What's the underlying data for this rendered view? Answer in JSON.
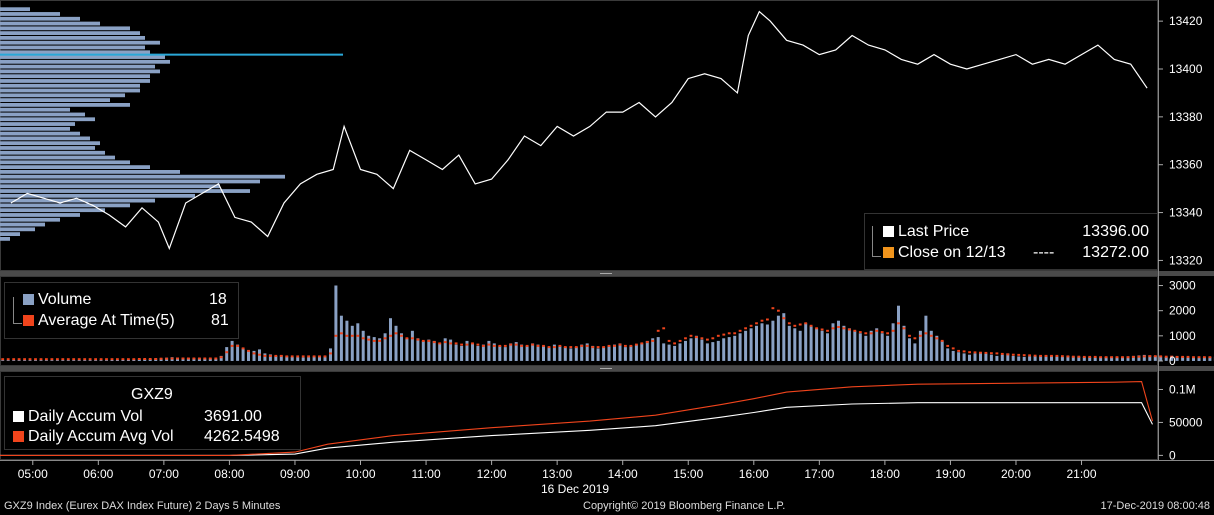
{
  "chart_data": [
    {
      "type": "line",
      "panel": "price",
      "series": [
        {
          "name": "Last Price",
          "color": "#ffffff",
          "x": [
            "04:40",
            "04:55",
            "05:10",
            "05:25",
            "05:40",
            "05:55",
            "06:10",
            "06:25",
            "06:40",
            "06:55",
            "07:05",
            "07:20",
            "07:35",
            "07:50",
            "08:05",
            "08:20",
            "08:35",
            "08:50",
            "09:05",
            "09:20",
            "09:35",
            "09:45",
            "10:00",
            "10:15",
            "10:30",
            "10:45",
            "11:00",
            "11:15",
            "11:30",
            "11:45",
            "12:00",
            "12:15",
            "12:30",
            "12:45",
            "13:00",
            "13:15",
            "13:30",
            "13:45",
            "14:00",
            "14:15",
            "14:30",
            "14:45",
            "15:00",
            "15:15",
            "15:30",
            "15:45",
            "15:55",
            "16:05",
            "16:15",
            "16:30",
            "16:45",
            "17:00",
            "17:15",
            "17:30",
            "17:45",
            "18:00",
            "18:15",
            "18:30",
            "18:45",
            "19:00",
            "19:15",
            "19:30",
            "19:45",
            "20:00",
            "20:15",
            "20:30",
            "20:45",
            "21:00",
            "21:15",
            "21:30",
            "21:45",
            "22:00"
          ],
          "y": [
            13344,
            13348,
            13346,
            13344,
            13346,
            13343,
            13339,
            13334,
            13342,
            13336,
            13325,
            13344,
            13348,
            13352,
            13338,
            13336,
            13330,
            13344,
            13352,
            13356,
            13358,
            13376,
            13358,
            13356,
            13350,
            13366,
            13362,
            13358,
            13364,
            13352,
            13354,
            13362,
            13372,
            13368,
            13376,
            13372,
            13376,
            13382,
            13382,
            13386,
            13380,
            13386,
            13396,
            13398,
            13396,
            13390,
            13414,
            13424,
            13420,
            13412,
            13410,
            13406,
            13408,
            13414,
            13410,
            13408,
            13404,
            13402,
            13406,
            13402,
            13400,
            13402,
            13404,
            13406,
            13402,
            13404,
            13402,
            13406,
            13410,
            13404,
            13402,
            13392
          ]
        },
        {
          "name": "Close on 12/13",
          "color": "#f0941c",
          "constant": 13272.0
        }
      ],
      "xlim": [
        "04:30",
        "22:10"
      ],
      "ylim": [
        13316,
        13428
      ],
      "yticks": [
        13320,
        13340,
        13360,
        13380,
        13400,
        13420
      ],
      "volume_profile": {
        "color": "#8aa1c4",
        "highlight_color": "#2aa8d8",
        "highlight_price": 13406,
        "levels": [
          13329,
          13331,
          13333,
          13335,
          13337,
          13339,
          13341,
          13343,
          13345,
          13347,
          13349,
          13351,
          13353,
          13355,
          13357,
          13359,
          13361,
          13363,
          13365,
          13367,
          13369,
          13371,
          13373,
          13375,
          13377,
          13379,
          13381,
          13383,
          13385,
          13387,
          13389,
          13391,
          13393,
          13395,
          13397,
          13399,
          13401,
          13403,
          13405,
          13407,
          13409,
          13411,
          13413,
          13415,
          13417,
          13419,
          13421,
          13423,
          13425
        ],
        "volumes": [
          10,
          20,
          35,
          45,
          60,
          80,
          105,
          130,
          155,
          195,
          250,
          220,
          260,
          285,
          180,
          150,
          130,
          115,
          105,
          95,
          100,
          90,
          80,
          70,
          75,
          95,
          85,
          70,
          130,
          110,
          125,
          140,
          140,
          150,
          150,
          160,
          155,
          170,
          165,
          150,
          145,
          160,
          145,
          140,
          130,
          100,
          80,
          60,
          30
        ],
        "max_volume": 343
      }
    },
    {
      "type": "bar",
      "panel": "volume",
      "legend": [
        {
          "label": "Volume",
          "value": "18",
          "color": "#8aa1c4"
        },
        {
          "label": "Average At Time(5)",
          "value": "81",
          "color": "#f0441c"
        }
      ],
      "x_start": "04:30",
      "interval_minutes": 5,
      "values": [
        30,
        30,
        30,
        30,
        30,
        30,
        30,
        30,
        30,
        30,
        30,
        30,
        30,
        30,
        30,
        30,
        30,
        30,
        30,
        30,
        40,
        40,
        50,
        50,
        60,
        70,
        80,
        80,
        100,
        110,
        130,
        150,
        140,
        130,
        120,
        110,
        110,
        100,
        100,
        90,
        200,
        550,
        800,
        650,
        500,
        420,
        400,
        460,
        300,
        260,
        200,
        220,
        180,
        160,
        150,
        140,
        150,
        180,
        200,
        190,
        500,
        3000,
        1800,
        1600,
        1400,
        1500,
        1200,
        1000,
        950,
        900,
        1100,
        1700,
        1400,
        1100,
        900,
        1200,
        900,
        800,
        850,
        800,
        700,
        900,
        850,
        650,
        600,
        800,
        700,
        600,
        650,
        800,
        700,
        600,
        550,
        700,
        750,
        650,
        600,
        700,
        650,
        600,
        550,
        650,
        600,
        550,
        500,
        550,
        650,
        700,
        600,
        500,
        550,
        600,
        650,
        700,
        550,
        600,
        650,
        700,
        800,
        900,
        950,
        700,
        650,
        600,
        700,
        800,
        900,
        1000,
        850,
        700,
        750,
        800,
        900,
        950,
        1000,
        1100,
        1200,
        1300,
        1400,
        1500,
        1450,
        1600,
        1800,
        1900,
        1400,
        1300,
        1200,
        1500,
        1400,
        1300,
        1200,
        1100,
        1500,
        1600,
        1400,
        1300,
        1200,
        1100,
        1000,
        1200,
        1300,
        1100,
        1000,
        1500,
        2200,
        1400,
        900,
        700,
        1200,
        1800,
        1200,
        1000,
        800,
        500,
        400,
        350,
        300,
        250,
        300,
        350,
        300,
        250,
        200,
        250,
        300,
        200,
        180,
        160,
        180,
        200,
        200,
        220,
        200,
        180,
        160,
        200,
        180,
        170,
        160,
        150,
        140,
        150,
        160,
        170,
        160,
        150,
        180,
        200,
        220,
        240,
        220,
        200,
        180,
        160,
        200,
        180,
        160,
        150,
        140,
        130,
        150,
        160,
        170,
        180,
        200,
        220,
        240,
        260,
        280,
        300,
        320,
        280,
        260,
        240,
        220,
        200,
        180,
        200,
        220,
        240,
        260,
        280,
        300,
        350,
        400,
        450,
        500,
        350
      ],
      "avg_values": [
        70,
        70,
        70,
        70,
        70,
        70,
        70,
        70,
        70,
        70,
        70,
        70,
        70,
        70,
        70,
        70,
        70,
        70,
        70,
        70,
        70,
        70,
        70,
        70,
        70,
        80,
        80,
        80,
        80,
        90,
        90,
        100,
        100,
        100,
        100,
        100,
        100,
        100,
        100,
        100,
        150,
        350,
        600,
        600,
        500,
        400,
        300,
        250,
        200,
        200,
        200,
        200,
        180,
        180,
        180,
        180,
        180,
        180,
        180,
        180,
        300,
        1000,
        1100,
        1000,
        1000,
        1000,
        900,
        850,
        800,
        800,
        900,
        1000,
        1100,
        1000,
        900,
        900,
        850,
        800,
        800,
        750,
        700,
        750,
        700,
        700,
        650,
        650,
        700,
        650,
        600,
        650,
        600,
        600,
        600,
        650,
        650,
        600,
        600,
        650,
        600,
        600,
        550,
        550,
        600,
        550,
        550,
        550,
        600,
        600,
        550,
        550,
        550,
        600,
        600,
        650,
        600,
        600,
        650,
        700,
        750,
        800,
        1200,
        1300,
        800,
        700,
        800,
        900,
        1000,
        950,
        900,
        850,
        900,
        1000,
        1050,
        1100,
        1100,
        1200,
        1300,
        1400,
        1500,
        1600,
        1650,
        2100,
        2000,
        1700,
        1500,
        1400,
        1450,
        1500,
        1400,
        1300,
        1250,
        1200,
        1300,
        1350,
        1300,
        1250,
        1200,
        1150,
        1100,
        1100,
        1200,
        1150,
        1100,
        1200,
        1500,
        1300,
        1000,
        900,
        1000,
        1100,
        1000,
        900,
        800,
        600,
        500,
        400,
        380,
        350,
        340,
        330,
        320,
        310,
        300,
        280,
        260,
        250,
        240,
        230,
        220,
        210,
        200,
        200,
        200,
        200,
        190,
        180,
        170,
        170,
        160,
        160,
        160,
        150,
        150,
        150,
        150,
        150,
        150,
        160,
        170,
        180,
        190,
        190,
        180,
        170,
        170,
        160,
        160,
        160,
        150,
        150,
        150,
        150,
        150,
        160,
        160,
        170,
        180,
        190,
        200,
        210,
        220,
        230,
        240,
        250,
        240,
        230,
        220,
        210,
        200,
        200,
        210,
        220,
        230,
        240,
        250,
        270,
        300,
        350,
        400,
        400
      ],
      "ylim": [
        -200,
        3300
      ],
      "yticks": [
        0,
        1000,
        2000,
        3000
      ]
    },
    {
      "type": "line",
      "panel": "accumulated",
      "title": "GXZ9",
      "series": [
        {
          "name": "Daily Accum Vol",
          "value": "3691.00",
          "color": "#ffffff",
          "x": [
            "04:30",
            "08:00",
            "09:00",
            "09:30",
            "10:30",
            "12:00",
            "13:30",
            "14:30",
            "15:30",
            "16:00",
            "16:30",
            "17:30",
            "18:30",
            "21:30",
            "21:55",
            "22:05"
          ],
          "y": [
            0,
            0,
            2000,
            11000,
            20000,
            30000,
            38000,
            45000,
            58000,
            65000,
            73000,
            78000,
            80000,
            80000,
            80000,
            47000
          ]
        },
        {
          "name": "Daily Accum Avg Vol",
          "value": "4262.5498",
          "color": "#f0441c",
          "x": [
            "04:30",
            "08:00",
            "09:00",
            "09:30",
            "10:30",
            "12:00",
            "13:30",
            "14:30",
            "15:30",
            "16:00",
            "16:30",
            "17:30",
            "18:30",
            "21:30",
            "21:55",
            "22:05"
          ],
          "y": [
            0,
            0,
            5000,
            17000,
            30000,
            42000,
            52000,
            61000,
            77000,
            86000,
            96000,
            104000,
            108000,
            111000,
            112000,
            52000
          ]
        }
      ],
      "ylim": [
        -7000,
        125000
      ],
      "yticks": [
        0,
        50000,
        100000
      ],
      "ytick_labels": [
        "0",
        "50000",
        "0.1M"
      ]
    }
  ],
  "axis": {
    "x_ticks": [
      "05:00",
      "06:00",
      "07:00",
      "08:00",
      "09:00",
      "10:00",
      "11:00",
      "12:00",
      "13:00",
      "14:00",
      "15:00",
      "16:00",
      "17:00",
      "18:00",
      "19:00",
      "20:00",
      "21:00"
    ],
    "date_label": "16 Dec 2019"
  },
  "price_legend": {
    "last_label": "Last Price",
    "last_value": "13396.00",
    "close_label": "Close on 12/13",
    "close_dashes": "----",
    "close_value": "13272.00"
  },
  "volume_legend": {
    "vol_label": "Volume",
    "vol_value": "18",
    "avg_label": "Average At Time(5)",
    "avg_value": "81"
  },
  "accum_legend": {
    "title": "GXZ9",
    "vol_label": "Daily Accum Vol",
    "vol_value": "3691.00",
    "avg_label": "Daily Accum Avg Vol",
    "avg_value": "4262.5498"
  },
  "footer": {
    "left": "GXZ9 Index (Eurex DAX Index Future) 2 Days 5 Minutes",
    "center": "Copyright© 2019 Bloomberg Finance L.P.",
    "right": "17-Dec-2019 08:00:48"
  },
  "colors": {
    "panel_border": "#5a5a5a",
    "axis_text": "#ffffff",
    "price_line": "#ffffff",
    "volume_bar": "#8aa1c4",
    "avg_marker": "#f0441c",
    "accum_vol": "#ffffff",
    "accum_avg": "#f0441c"
  }
}
